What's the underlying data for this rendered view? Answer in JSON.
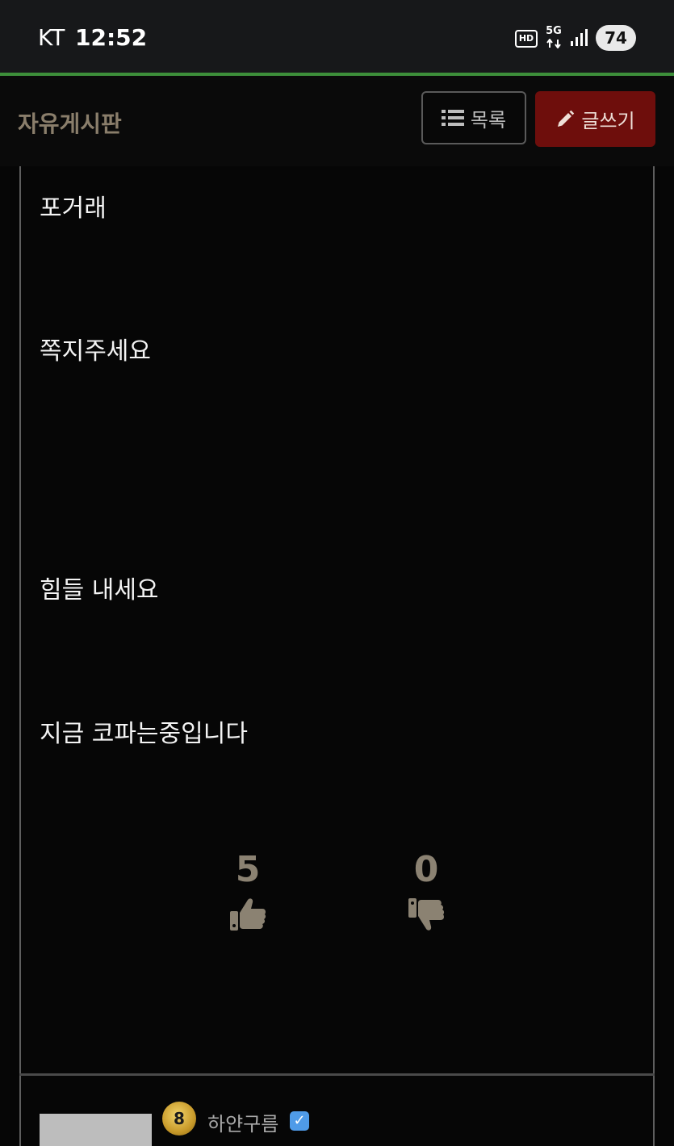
{
  "status_bar": {
    "carrier": "KT",
    "time": "12:52",
    "hd_label": "HD",
    "network_label": "5G",
    "battery_level": "74"
  },
  "header": {
    "board_title": "자유게시판",
    "list_button": "목록",
    "write_button": "글쓰기"
  },
  "post": {
    "lines": [
      "포거래",
      "쪽지주세요",
      "힘들 내세요",
      "지금 코파는중입니다"
    ]
  },
  "votes": {
    "up_count": "5",
    "down_count": "0"
  },
  "comment": {
    "level": "8",
    "username": "하얀구름"
  },
  "colors": {
    "accent_green": "#3d8f3a",
    "write_button_bg": "#6e0e0c",
    "title_color": "#8a7e6b",
    "vote_color": "#8b8272"
  },
  "icons": {
    "list": "list-icon",
    "write": "pencil-icon",
    "thumb_up": "thumbs-up-icon",
    "thumb_down": "thumbs-down-icon",
    "verified": "check-badge-icon"
  }
}
